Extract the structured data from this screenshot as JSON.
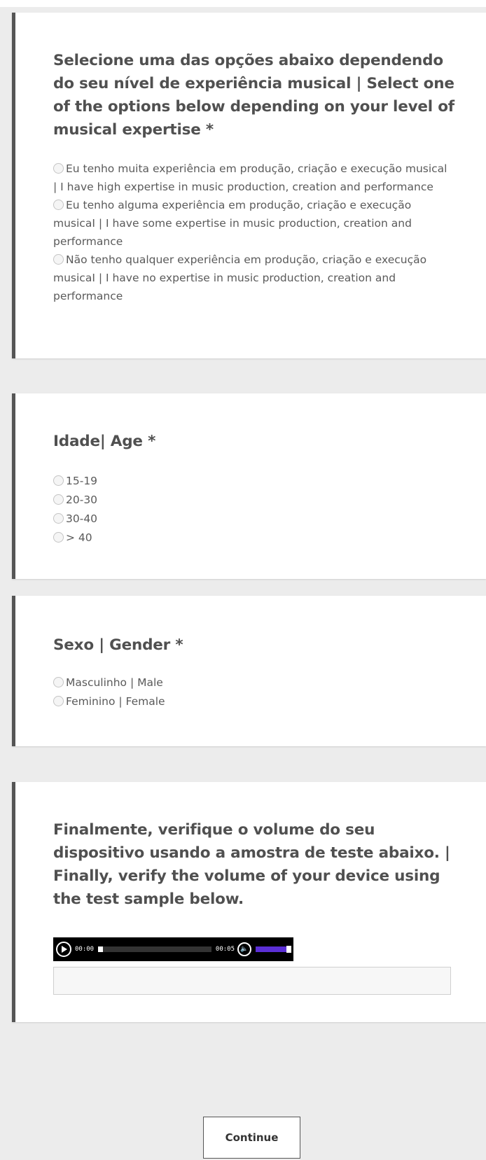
{
  "questions": {
    "expertise": {
      "title": "Selecione uma das opções abaixo dependendo do seu nível de experiência musical | Select one of the options below depending on your level of musical expertise *",
      "options": [
        "Eu tenho muita experiência em produção, criação e execução musical | I have high expertise in music production, creation and performance",
        "Eu tenho alguma experiência em produção, criação e execução musicaI | I have some expertise in music production, creation and performance",
        "Não tenho qualquer experiência em produção, criação e execução musicaI | I have no expertise in music production, creation and performance"
      ]
    },
    "age": {
      "title": "Idade| Age *",
      "options": [
        "15-19",
        "20-30",
        "30-40",
        "> 40"
      ]
    },
    "gender": {
      "title": "Sexo | Gender *",
      "options": [
        "Masculinho | Male",
        "Feminino | Female"
      ]
    },
    "volume": {
      "title": "Finalmente, verifique o volume do seu dispositivo usando a amostra de teste abaixo. | Finally, verify the volume of your device using the test sample below.",
      "player": {
        "current_time": "00:00",
        "duration": "00:05",
        "progress": 0.0,
        "volume": 1.0,
        "volume_color": "#5b2fd6"
      },
      "text_value": ""
    }
  },
  "continue_label": "Continue",
  "colors": {
    "background": "#ececec",
    "card": "#ffffff",
    "card_border": "#555555",
    "title": "#505050"
  }
}
